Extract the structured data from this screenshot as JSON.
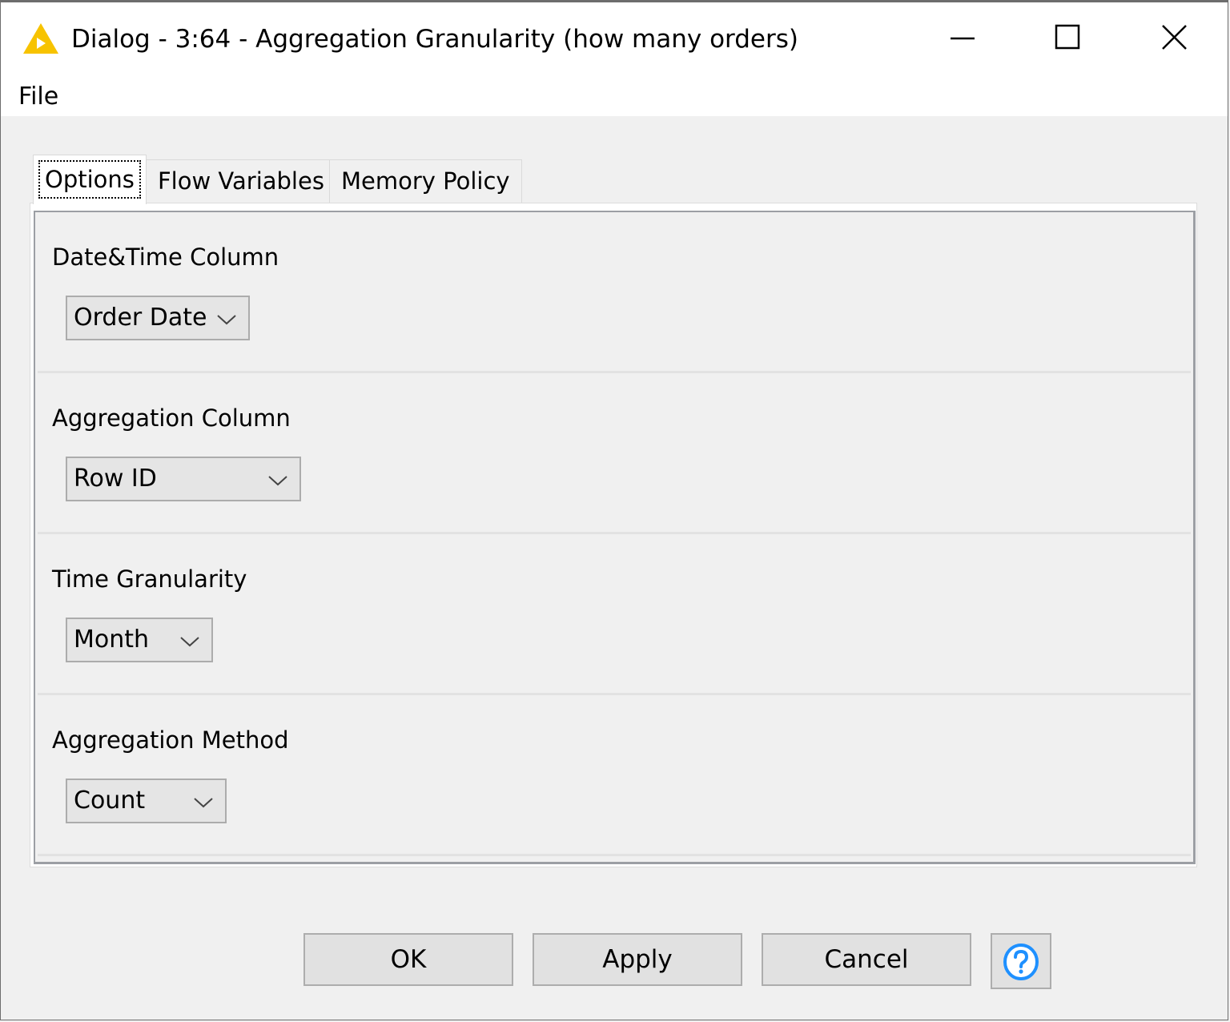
{
  "window": {
    "title": "Dialog - 3:64 - Aggregation Granularity (how many orders)",
    "app_icon": "knime-warning-triangle-icon",
    "controls": {
      "minimize": "minimize-icon",
      "maximize": "maximize-icon",
      "close": "close-icon"
    }
  },
  "menubar": {
    "items": [
      {
        "label": "File"
      }
    ]
  },
  "tabs": [
    {
      "label": "Options",
      "active": true
    },
    {
      "label": "Flow Variables",
      "active": false
    },
    {
      "label": "Memory Policy",
      "active": false
    }
  ],
  "sections": [
    {
      "label": "Date&Time Column",
      "selected": "Order Date"
    },
    {
      "label": "Aggregation Column",
      "selected": "Row ID"
    },
    {
      "label": "Time Granularity",
      "selected": "Month"
    },
    {
      "label": "Aggregation Method",
      "selected": "Count"
    }
  ],
  "buttons": {
    "ok": "OK",
    "apply": "Apply",
    "cancel": "Cancel",
    "help_icon": "help-question-icon"
  },
  "colors": {
    "app_icon": "#f7c300",
    "help_icon": "#1e90ff",
    "panel_border": "#9c9fa4"
  }
}
